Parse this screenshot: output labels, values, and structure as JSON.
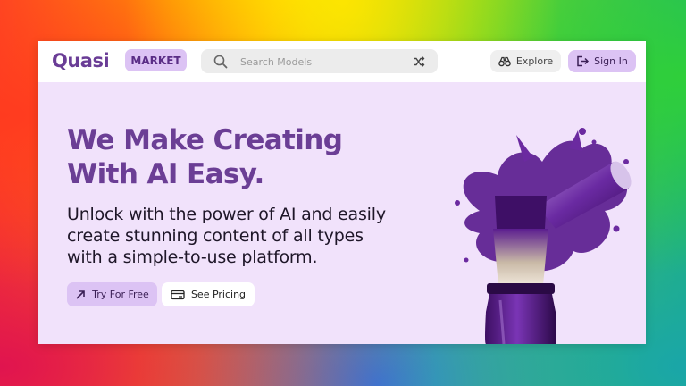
{
  "brand": {
    "logo_text": "Quasi",
    "badge": "MARKET"
  },
  "search": {
    "placeholder": "Search Models",
    "value": ""
  },
  "nav": {
    "explore_label": "Explore",
    "signin_label": "Sign In"
  },
  "hero": {
    "headline_line1": "We Make Creating",
    "headline_line2": "With AI Easy.",
    "sub_line1": "Unlock with the power of AI and easily",
    "sub_line2": "create stunning content of all types",
    "sub_line3": "with a simple-to-use platform.",
    "try_label": "Try For Free",
    "pricing_label": "See Pricing"
  },
  "colors": {
    "accent": "#dcc3f4",
    "brand": "#6b3e95",
    "hero_bg": "#f1e2fb",
    "paint": "#5b1d8f"
  },
  "icons": {
    "search": "search-icon",
    "shuffle": "shuffle-icon",
    "explore": "binoculars-icon",
    "signin": "sign-in-icon",
    "try": "arrow-up-right-icon",
    "pricing": "price-tag-icon"
  }
}
